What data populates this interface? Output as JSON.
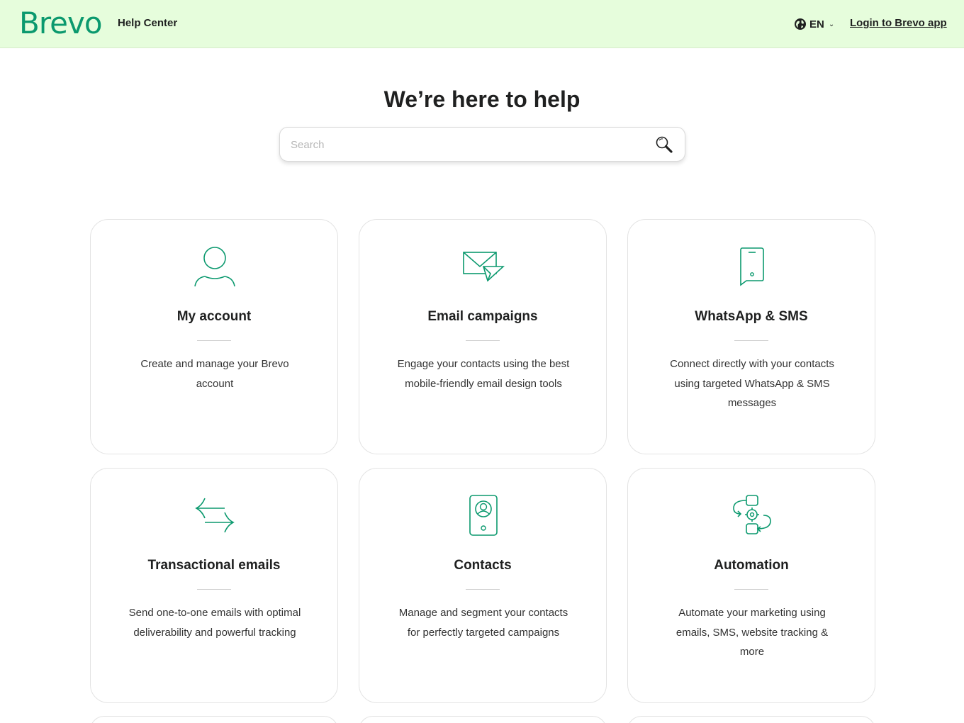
{
  "header": {
    "logo_text": "Brevo",
    "help_center_label": "Help Center",
    "language": "EN",
    "login_label": "Login to Brevo app",
    "background_color": "#e6fddc",
    "brand_color": "#0b996e"
  },
  "hero": {
    "title": "We’re here to help"
  },
  "search": {
    "placeholder": "Search",
    "value": ""
  },
  "cards": [
    {
      "icon": "user-icon",
      "title": "My account",
      "description": "Create and manage your Brevo account"
    },
    {
      "icon": "envelope-paper-plane-icon",
      "title": "Email campaigns",
      "description": "Engage your contacts using the best mobile-friendly email design tools"
    },
    {
      "icon": "smartphone-chat-icon",
      "title": "WhatsApp & SMS",
      "description": "Connect directly with your contacts using targeted WhatsApp & SMS messages"
    },
    {
      "icon": "transfer-arrows-icon",
      "title": "Transactional emails",
      "description": "Send one-to-one emails with optimal deliverability and powerful tracking"
    },
    {
      "icon": "contact-card-icon",
      "title": "Contacts",
      "description": "Manage and segment your contacts for perfectly targeted campaigns"
    },
    {
      "icon": "workflow-gear-icon",
      "title": "Automation",
      "description": "Automate your marketing using emails, SMS, website tracking & more"
    }
  ]
}
